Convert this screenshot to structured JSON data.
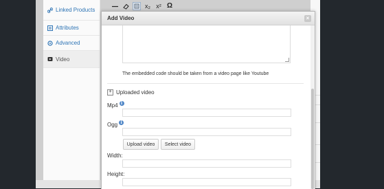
{
  "product_tabs": [
    {
      "label": "Linked Products",
      "icon": "link-icon"
    },
    {
      "label": "Attributes",
      "icon": "attributes-icon"
    },
    {
      "label": "Advanced",
      "icon": "gear-icon"
    },
    {
      "label": "Video",
      "icon": "video-icon"
    }
  ],
  "active_tab": "Video",
  "toolbar": {
    "omega_symbol": "Ω",
    "subscript_symbol": "x₂",
    "superscript_symbol": "x²"
  },
  "modal": {
    "title": "Add Video",
    "close_symbol": "×",
    "embed_hint": "The embedded code should be taken from a video page like Youtube",
    "uploaded_video_label": "Uploaded video",
    "toggle_symbol": "+",
    "mp4_label": "Mp4",
    "ogg_label": "Ogg",
    "info_symbol": "i",
    "upload_button": "Upload video",
    "select_button": "Select video",
    "width_label": "Width:",
    "height_label": "Height:",
    "mp4_value": "",
    "ogg_value": "",
    "width_value": "",
    "height_value": ""
  },
  "colors": {
    "link": "#2e74b5",
    "info": "#4f86c6",
    "backdrop": "#23282d"
  }
}
